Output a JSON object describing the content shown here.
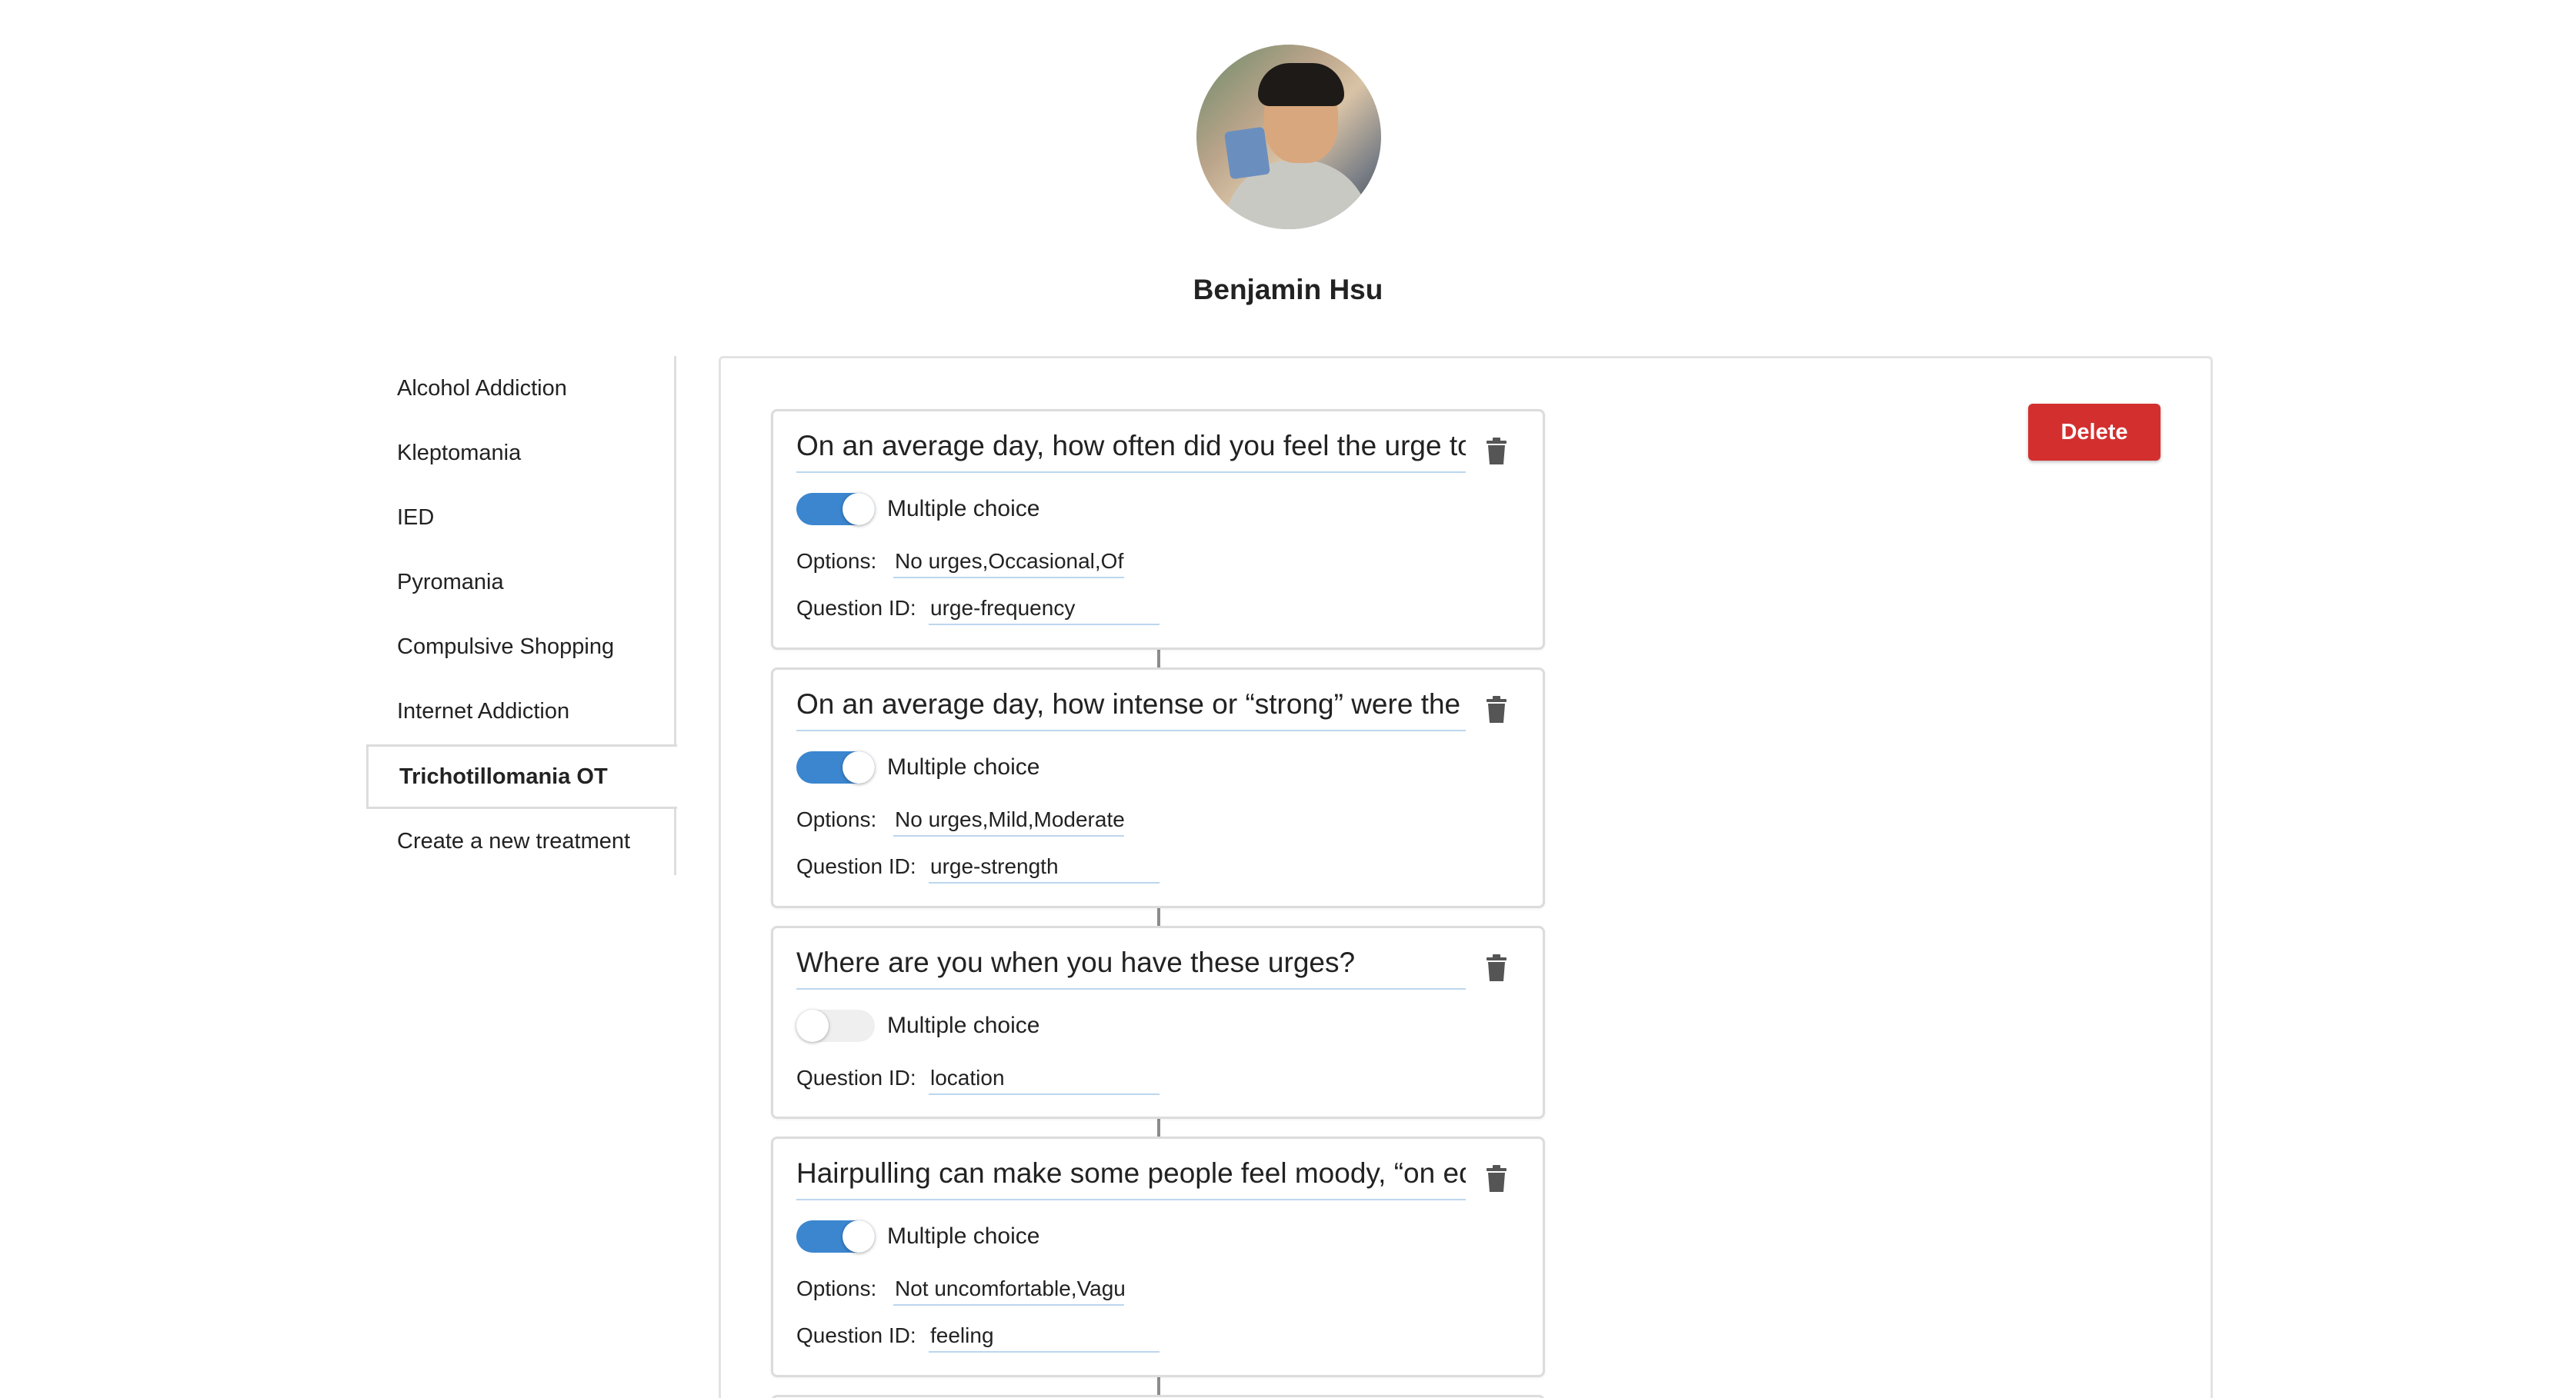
{
  "profile": {
    "name": "Benjamin Hsu"
  },
  "sidebar": {
    "items": [
      {
        "label": "Alcohol Addiction"
      },
      {
        "label": "Kleptomania"
      },
      {
        "label": "IED"
      },
      {
        "label": "Pyromania"
      },
      {
        "label": "Compulsive Shopping"
      },
      {
        "label": "Internet Addiction"
      },
      {
        "label": "Trichotillomania OT",
        "active": true
      },
      {
        "label": "Create a new treatment"
      }
    ]
  },
  "toolbar": {
    "delete_label": "Delete"
  },
  "labels": {
    "multiple_choice": "Multiple choice",
    "options": "Options:",
    "question_id": "Question ID:"
  },
  "questions": [
    {
      "title": "On an average day, how often  did you feel the urge to pu",
      "multiple_choice": true,
      "options": "No urges,Occasional,Oft",
      "question_id": "urge-frequency"
    },
    {
      "title": "On an average day, how intense  or “strong” were the ur",
      "multiple_choice": true,
      "options": "No urges,Mild,Moderate",
      "question_id": "urge-strength"
    },
    {
      "title": "Where are you when you have these urges?",
      "multiple_choice": false,
      "options": "",
      "question_id": "location"
    },
    {
      "title": "Hairpulling can make some  people feel moody, “on edge",
      "multiple_choice": true,
      "options": "Not uncomfortable,Vagu",
      "question_id": "feeling"
    }
  ],
  "colors": {
    "accent": "#3b86cf",
    "danger": "#d32f2f",
    "border": "#dcdcdc"
  },
  "icons": {
    "trash": "trash-icon"
  }
}
